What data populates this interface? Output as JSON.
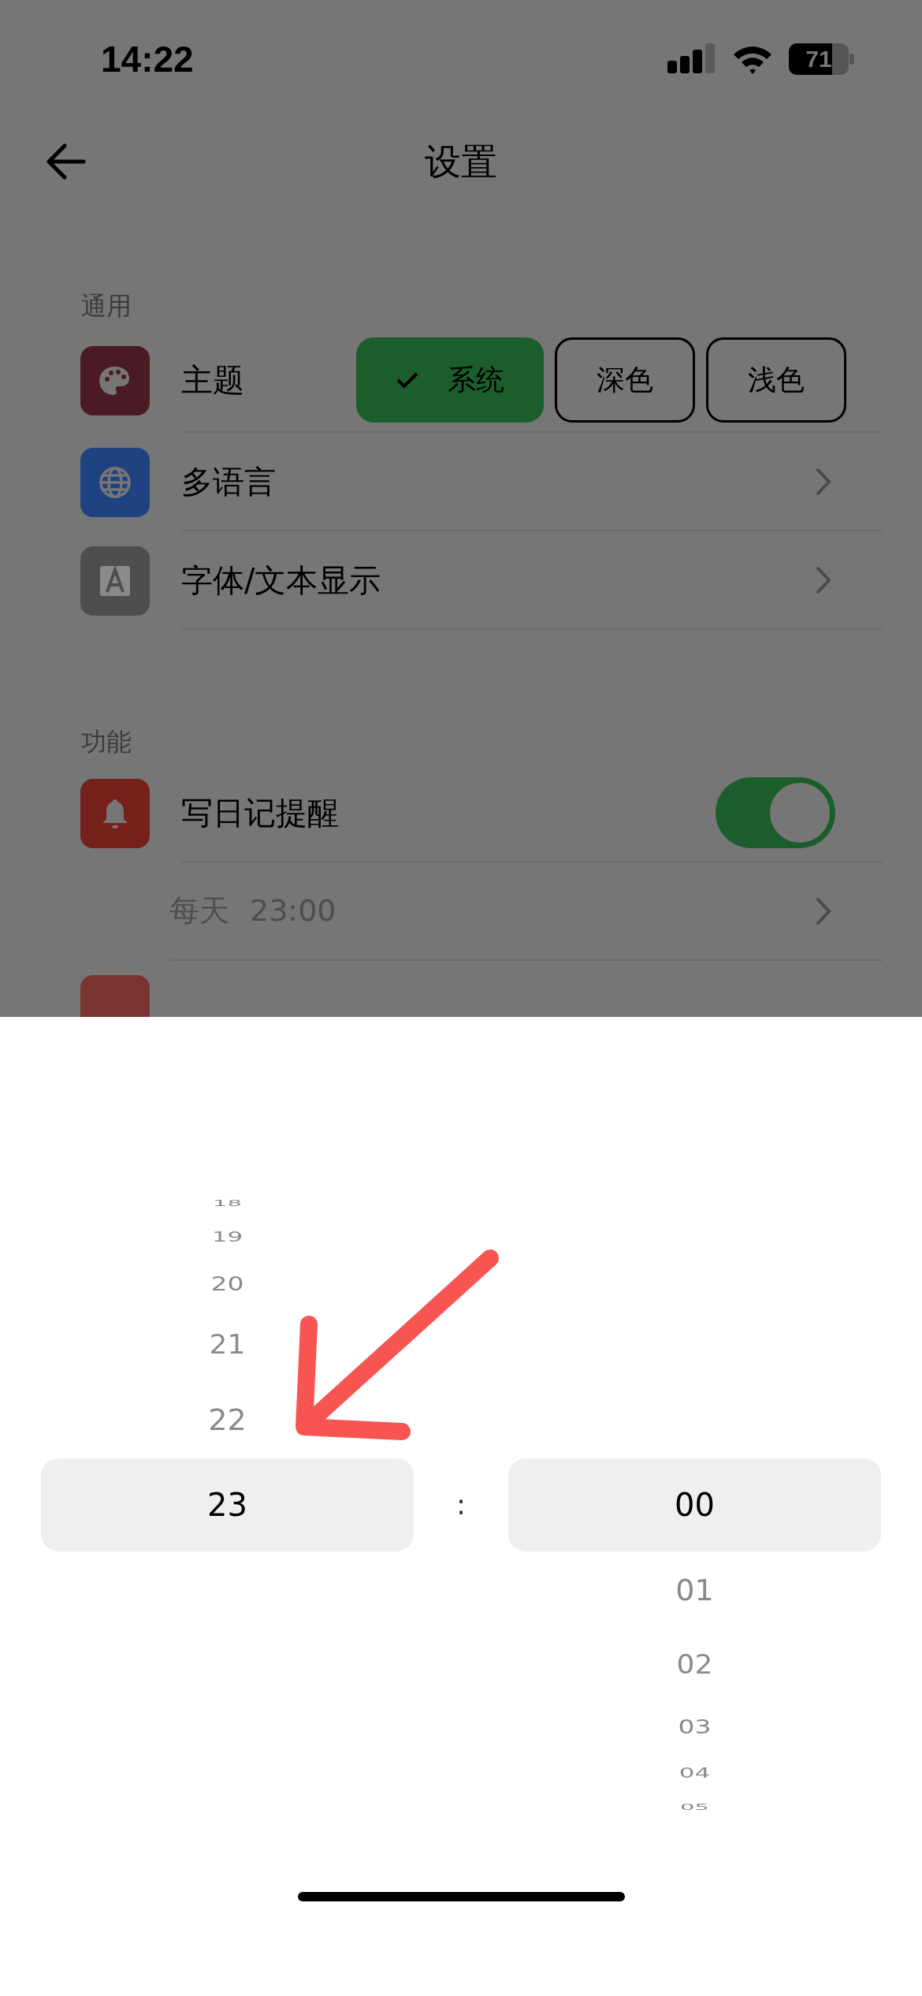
{
  "status_bar": {
    "time": "14:22",
    "battery": "71"
  },
  "header": {
    "title": "设置"
  },
  "sections": [
    {
      "title": "通用",
      "rows": [
        {
          "kind": "segmented",
          "label": "主题",
          "color": "#4a1b24",
          "options": [
            {
              "label": "系统",
              "selected": true
            },
            {
              "label": "深色",
              "selected": false
            },
            {
              "label": "浅色",
              "selected": false
            }
          ]
        },
        {
          "kind": "link",
          "label": "多语言",
          "color": "#1f4380"
        },
        {
          "kind": "link",
          "label": "字体/文本显示",
          "color": "#4e4e4e"
        }
      ]
    },
    {
      "title": "功能",
      "rows": [
        {
          "kind": "toggle",
          "label": "写日记提醒",
          "color": "#76201b",
          "on": true
        },
        {
          "kind": "sublink",
          "repeat": "每天",
          "time": "23:00"
        },
        {
          "kind": "cut_off",
          "color": "#7a3430"
        }
      ]
    }
  ],
  "time_picker": {
    "hours": [
      {
        "label": "18",
        "selected": false
      },
      {
        "label": "19",
        "selected": false
      },
      {
        "label": "20",
        "selected": false
      },
      {
        "label": "21",
        "selected": false
      },
      {
        "label": "22",
        "selected": false
      },
      {
        "label": "23",
        "selected": true
      }
    ],
    "separator": ":",
    "minutes": [
      {
        "label": "00",
        "selected": true
      },
      {
        "label": "01",
        "selected": false
      },
      {
        "label": "02",
        "selected": false
      },
      {
        "label": "03",
        "selected": false
      },
      {
        "label": "04",
        "selected": false
      },
      {
        "label": "05",
        "selected": false
      }
    ]
  }
}
